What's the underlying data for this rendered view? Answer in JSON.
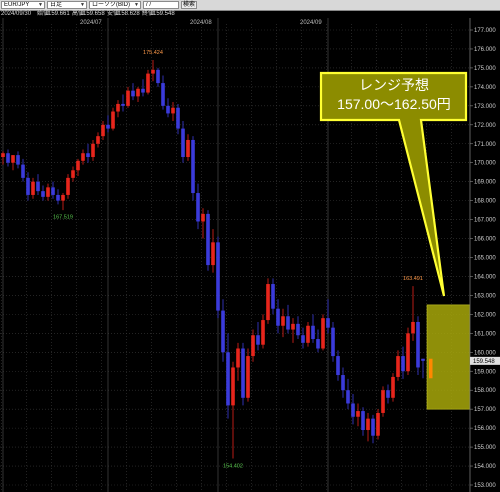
{
  "toolbar": {
    "symbol": "EUR/JPY",
    "timeframe": "日足",
    "chart_style": "ローソク(BID)",
    "date_value": "/ /",
    "search_label": "検索"
  },
  "ohlc_bar": {
    "date": "2024/09/30",
    "open_label": "始値",
    "open_value": "159.661",
    "high_label": "高値",
    "high_value": "159.658",
    "low_label": "安値",
    "low_value": "158.628",
    "close_label": "終値",
    "close_value": "159.548"
  },
  "callout": {
    "title": "レンジ予想",
    "range": "157.00～162.50円"
  },
  "colors": {
    "up": "#e8251c",
    "down": "#3b3bdb",
    "grid": "#3a3a3a",
    "range_box": "#a8a80a",
    "callout_fill": "#8c8c00",
    "callout_border": "#ffff33"
  },
  "chart_data": {
    "type": "candlestick",
    "symbol": "EUR/JPY",
    "ylim": [
      153.0,
      177.0
    ],
    "y_ticks": [
      "177.000",
      "176.000",
      "175.000",
      "174.000",
      "173.000",
      "172.000",
      "171.000",
      "170.000",
      "169.000",
      "168.000",
      "167.000",
      "166.000",
      "165.000",
      "164.000",
      "163.000",
      "162.000",
      "161.000",
      "160.000",
      "159.000",
      "158.000",
      "157.000",
      "156.000",
      "155.000",
      "154.000",
      "153.000"
    ],
    "x_ticks": [
      {
        "label": "2024/06",
        "index": 0
      },
      {
        "label": "2024/07",
        "index": 21
      },
      {
        "label": "2024/08",
        "index": 43
      },
      {
        "label": "2024/09",
        "index": 65
      }
    ],
    "current_price": "159.548",
    "annotations": [
      {
        "label": "175.424",
        "index": 30,
        "value": 175.42,
        "pos": "high"
      },
      {
        "label": "167.519",
        "index": 12,
        "value": 167.52,
        "pos": "low"
      },
      {
        "label": "154.402",
        "index": 46,
        "value": 154.4,
        "pos": "low"
      },
      {
        "label": "163.491",
        "index": 82,
        "value": 163.49,
        "pos": "high"
      }
    ],
    "range_forecast": {
      "low": 157.0,
      "high": 162.5
    },
    "candles": [
      {
        "o": 170.3,
        "h": 170.6,
        "l": 169.9,
        "c": 170.5
      },
      {
        "o": 170.5,
        "h": 170.7,
        "l": 169.8,
        "c": 170.0
      },
      {
        "o": 170.0,
        "h": 170.4,
        "l": 169.6,
        "c": 170.4
      },
      {
        "o": 170.4,
        "h": 170.6,
        "l": 169.7,
        "c": 169.9
      },
      {
        "o": 169.9,
        "h": 170.2,
        "l": 169.0,
        "c": 169.2
      },
      {
        "o": 169.2,
        "h": 169.5,
        "l": 168.0,
        "c": 168.3
      },
      {
        "o": 168.3,
        "h": 169.2,
        "l": 168.1,
        "c": 169.0
      },
      {
        "o": 169.0,
        "h": 169.4,
        "l": 168.3,
        "c": 168.5
      },
      {
        "o": 168.5,
        "h": 168.8,
        "l": 168.0,
        "c": 168.2
      },
      {
        "o": 168.2,
        "h": 168.9,
        "l": 168.0,
        "c": 168.7
      },
      {
        "o": 168.7,
        "h": 169.0,
        "l": 168.1,
        "c": 168.3
      },
      {
        "o": 168.3,
        "h": 168.6,
        "l": 167.8,
        "c": 168.0
      },
      {
        "o": 168.0,
        "h": 168.4,
        "l": 167.5,
        "c": 168.3
      },
      {
        "o": 168.3,
        "h": 169.4,
        "l": 168.1,
        "c": 169.2
      },
      {
        "o": 169.2,
        "h": 169.8,
        "l": 169.0,
        "c": 169.6
      },
      {
        "o": 169.6,
        "h": 170.2,
        "l": 169.3,
        "c": 170.1
      },
      {
        "o": 170.1,
        "h": 170.7,
        "l": 169.9,
        "c": 170.5
      },
      {
        "o": 170.5,
        "h": 171.0,
        "l": 170.0,
        "c": 170.3
      },
      {
        "o": 170.3,
        "h": 171.2,
        "l": 170.1,
        "c": 171.0
      },
      {
        "o": 171.0,
        "h": 171.6,
        "l": 170.8,
        "c": 171.4
      },
      {
        "o": 171.4,
        "h": 172.2,
        "l": 171.2,
        "c": 172.0
      },
      {
        "o": 172.0,
        "h": 172.5,
        "l": 171.6,
        "c": 171.8
      },
      {
        "o": 171.8,
        "h": 172.9,
        "l": 171.7,
        "c": 172.7
      },
      {
        "o": 172.7,
        "h": 173.3,
        "l": 172.4,
        "c": 173.1
      },
      {
        "o": 173.1,
        "h": 173.6,
        "l": 172.7,
        "c": 173.0
      },
      {
        "o": 173.0,
        "h": 174.0,
        "l": 172.9,
        "c": 173.8
      },
      {
        "o": 173.8,
        "h": 174.2,
        "l": 173.3,
        "c": 173.5
      },
      {
        "o": 173.5,
        "h": 174.0,
        "l": 173.2,
        "c": 173.9
      },
      {
        "o": 173.9,
        "h": 174.4,
        "l": 173.5,
        "c": 173.7
      },
      {
        "o": 173.7,
        "h": 174.9,
        "l": 173.6,
        "c": 174.7
      },
      {
        "o": 174.7,
        "h": 175.42,
        "l": 174.3,
        "c": 174.9
      },
      {
        "o": 174.9,
        "h": 175.0,
        "l": 174.0,
        "c": 174.2
      },
      {
        "o": 174.2,
        "h": 174.6,
        "l": 172.8,
        "c": 173.0
      },
      {
        "o": 173.0,
        "h": 173.4,
        "l": 172.4,
        "c": 172.6
      },
      {
        "o": 172.6,
        "h": 173.2,
        "l": 172.2,
        "c": 172.9
      },
      {
        "o": 172.9,
        "h": 173.1,
        "l": 171.5,
        "c": 171.8
      },
      {
        "o": 171.8,
        "h": 172.2,
        "l": 170.0,
        "c": 170.3
      },
      {
        "o": 170.3,
        "h": 171.5,
        "l": 170.1,
        "c": 171.2
      },
      {
        "o": 171.2,
        "h": 171.4,
        "l": 168.0,
        "c": 168.4
      },
      {
        "o": 168.4,
        "h": 168.9,
        "l": 166.5,
        "c": 166.9
      },
      {
        "o": 166.9,
        "h": 167.6,
        "l": 166.0,
        "c": 167.3
      },
      {
        "o": 167.3,
        "h": 167.5,
        "l": 164.3,
        "c": 164.6
      },
      {
        "o": 164.6,
        "h": 166.5,
        "l": 164.2,
        "c": 165.8
      },
      {
        "o": 165.8,
        "h": 166.1,
        "l": 161.8,
        "c": 162.2
      },
      {
        "o": 162.2,
        "h": 162.8,
        "l": 159.5,
        "c": 160.0
      },
      {
        "o": 160.0,
        "h": 161.0,
        "l": 156.5,
        "c": 157.2
      },
      {
        "o": 157.2,
        "h": 159.5,
        "l": 154.4,
        "c": 159.2
      },
      {
        "o": 159.2,
        "h": 160.5,
        "l": 158.5,
        "c": 160.2
      },
      {
        "o": 160.2,
        "h": 160.5,
        "l": 157.2,
        "c": 157.6
      },
      {
        "o": 157.6,
        "h": 160.2,
        "l": 157.4,
        "c": 159.8
      },
      {
        "o": 159.8,
        "h": 161.2,
        "l": 159.5,
        "c": 160.9
      },
      {
        "o": 160.9,
        "h": 161.6,
        "l": 160.1,
        "c": 160.4
      },
      {
        "o": 160.4,
        "h": 162.0,
        "l": 160.2,
        "c": 161.7
      },
      {
        "o": 161.7,
        "h": 163.9,
        "l": 161.5,
        "c": 163.6
      },
      {
        "o": 163.6,
        "h": 163.9,
        "l": 162.0,
        "c": 162.3
      },
      {
        "o": 162.3,
        "h": 162.8,
        "l": 161.0,
        "c": 161.4
      },
      {
        "o": 161.4,
        "h": 162.3,
        "l": 160.8,
        "c": 161.9
      },
      {
        "o": 161.9,
        "h": 162.5,
        "l": 161.0,
        "c": 161.2
      },
      {
        "o": 161.2,
        "h": 161.8,
        "l": 160.5,
        "c": 161.5
      },
      {
        "o": 161.5,
        "h": 161.9,
        "l": 160.7,
        "c": 160.9
      },
      {
        "o": 160.9,
        "h": 161.3,
        "l": 160.2,
        "c": 160.5
      },
      {
        "o": 160.5,
        "h": 161.6,
        "l": 160.3,
        "c": 161.4
      },
      {
        "o": 161.4,
        "h": 162.0,
        "l": 160.5,
        "c": 160.7
      },
      {
        "o": 160.7,
        "h": 161.2,
        "l": 160.0,
        "c": 160.2
      },
      {
        "o": 160.2,
        "h": 162.0,
        "l": 160.1,
        "c": 161.8
      },
      {
        "o": 161.8,
        "h": 162.8,
        "l": 161.0,
        "c": 161.3
      },
      {
        "o": 161.3,
        "h": 161.6,
        "l": 159.5,
        "c": 159.8
      },
      {
        "o": 159.8,
        "h": 160.1,
        "l": 158.5,
        "c": 158.8
      },
      {
        "o": 158.8,
        "h": 159.2,
        "l": 157.6,
        "c": 158.0
      },
      {
        "o": 158.0,
        "h": 158.6,
        "l": 157.0,
        "c": 157.3
      },
      {
        "o": 157.3,
        "h": 157.8,
        "l": 156.2,
        "c": 156.6
      },
      {
        "o": 156.6,
        "h": 157.3,
        "l": 156.1,
        "c": 156.9
      },
      {
        "o": 156.9,
        "h": 157.1,
        "l": 155.6,
        "c": 155.9
      },
      {
        "o": 155.9,
        "h": 156.8,
        "l": 155.3,
        "c": 156.5
      },
      {
        "o": 156.5,
        "h": 156.7,
        "l": 155.2,
        "c": 155.6
      },
      {
        "o": 155.6,
        "h": 157.0,
        "l": 155.4,
        "c": 156.8
      },
      {
        "o": 156.8,
        "h": 158.2,
        "l": 156.6,
        "c": 158.0
      },
      {
        "o": 158.0,
        "h": 158.3,
        "l": 157.3,
        "c": 157.6
      },
      {
        "o": 157.6,
        "h": 158.9,
        "l": 157.4,
        "c": 158.7
      },
      {
        "o": 158.7,
        "h": 160.1,
        "l": 158.5,
        "c": 159.8
      },
      {
        "o": 159.8,
        "h": 160.3,
        "l": 158.6,
        "c": 159.0
      },
      {
        "o": 159.0,
        "h": 161.3,
        "l": 158.8,
        "c": 161.0
      },
      {
        "o": 161.0,
        "h": 163.49,
        "l": 160.6,
        "c": 161.6
      },
      {
        "o": 161.6,
        "h": 161.9,
        "l": 158.8,
        "c": 159.2
      },
      {
        "o": 159.66,
        "h": 159.66,
        "l": 158.63,
        "c": 159.55
      }
    ]
  }
}
